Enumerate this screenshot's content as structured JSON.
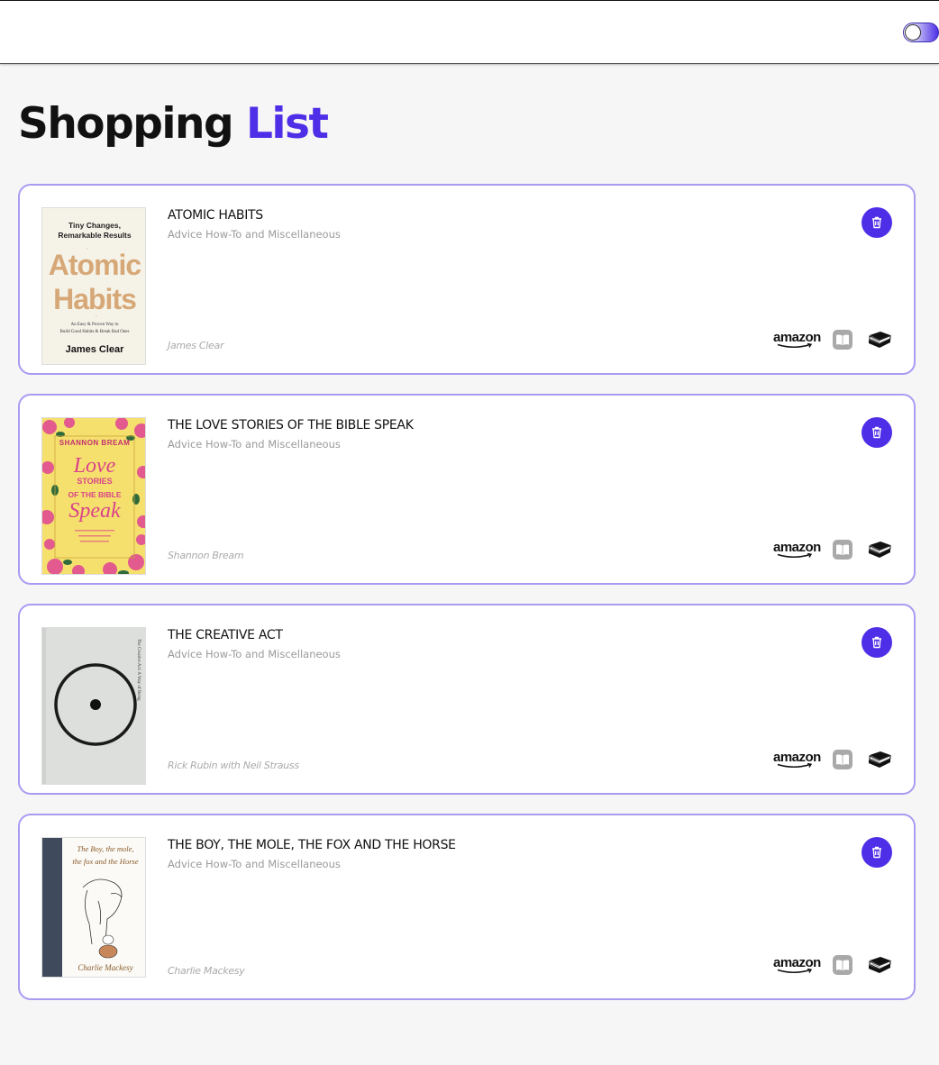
{
  "header": {
    "toggle_label": "theme toggle"
  },
  "page": {
    "title_part1": "Shopping",
    "title_part2": "List",
    "accent_color": "#4f2ee8"
  },
  "shop_labels": {
    "amazon": "amazon"
  },
  "books": [
    {
      "title": "ATOMIC HABITS",
      "category": "Advice How-To and Miscellaneous",
      "author": "James Clear",
      "cover": {
        "tagline": "Tiny Changes, Remarkable Results",
        "title_line1": "Atomic",
        "title_line2": "Habits",
        "subtitle": "An Easy & Proven Way to Build Good Habits & Break Bad Ones",
        "author": "James Clear"
      }
    },
    {
      "title": "THE LOVE STORIES OF THE BIBLE SPEAK",
      "category": "Advice How-To and Miscellaneous",
      "author": "Shannon Bream",
      "cover": {
        "author": "SHANNON BREAM",
        "title_line1": "Love",
        "title_line2": "STORIES",
        "title_line3": "OF THE BIBLE",
        "title_line4": "Speak"
      }
    },
    {
      "title": "THE CREATIVE ACT",
      "category": "Advice How-To and Miscellaneous",
      "author": "Rick Rubin with Neil Strauss",
      "cover": {
        "side_text": "The Creative Act: A Way of Being"
      }
    },
    {
      "title": "THE BOY, THE MOLE, THE FOX AND THE HORSE",
      "category": "Advice How-To and Miscellaneous",
      "author": "Charlie Mackesy",
      "cover": {
        "title": "The Boy, the mole, the fox and the Horse",
        "author": "Charlie Mackesy"
      }
    }
  ]
}
